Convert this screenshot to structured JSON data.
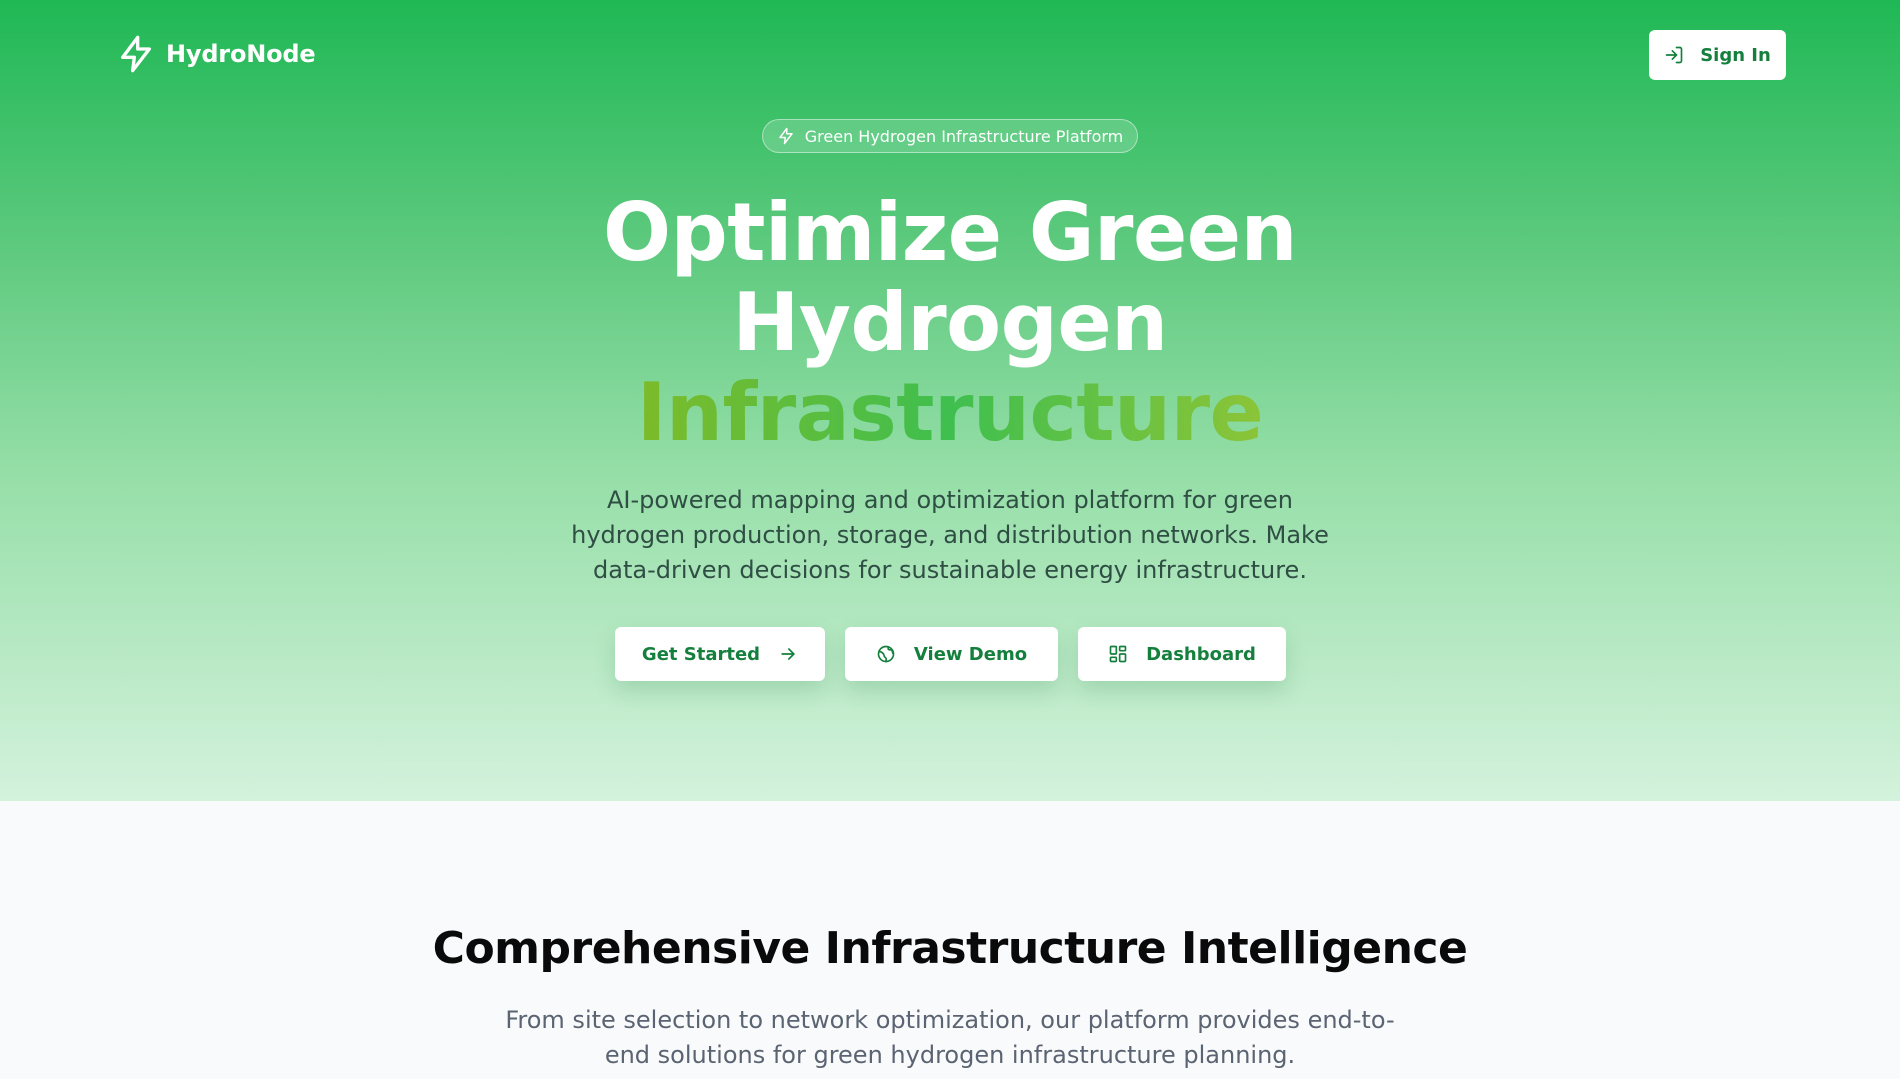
{
  "brand": {
    "name": "HydroNode",
    "logo_icon": "lightning-bolt-icon",
    "colors": {
      "primary": "#15803d",
      "hero_top": "#1fb855",
      "hero_bottom": "#d4f2dc",
      "accent_text": "#4fbf3f"
    }
  },
  "header": {
    "sign_in_label": "Sign In",
    "sign_in_icon": "sign-in-icon"
  },
  "hero": {
    "badge_label": "Green Hydrogen Infrastructure Platform",
    "badge_icon": "lightning-bolt-icon",
    "headline_line1": "Optimize Green",
    "headline_line2": "Hydrogen",
    "headline_accent": "Infrastructure",
    "subtitle": "AI-powered mapping and optimization platform for green hydrogen production, storage, and distribution networks. Make data-driven decisions for sustainable energy infrastructure.",
    "buttons": [
      {
        "label": "Get Started",
        "icon": "arrow-right-icon"
      },
      {
        "label": "View Demo",
        "icon": "globe-icon"
      },
      {
        "label": "Dashboard",
        "icon": "dashboard-grid-icon"
      }
    ]
  },
  "features": {
    "title": "Comprehensive Infrastructure Intelligence",
    "description": "From site selection to network optimization, our platform provides end-to-end solutions for green hydrogen infrastructure planning."
  }
}
